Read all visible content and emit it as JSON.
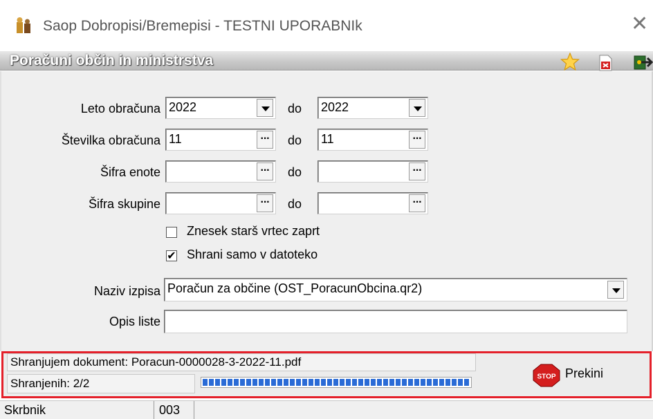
{
  "window": {
    "title": "Saop Dobropisi/Bremepisi - TESTNI UPORABNIk",
    "close_glyph": "✕"
  },
  "header": {
    "title": "Poračuni občin in ministrstva",
    "icons": [
      "star-icon",
      "pdf-delete-icon",
      "exit-icon"
    ]
  },
  "form": {
    "leto": {
      "label": "Leto obračuna",
      "from": "2022",
      "to": "2022",
      "do": "do"
    },
    "stevilka": {
      "label": "Številka obračuna",
      "from": "11",
      "to": "11",
      "do": "do"
    },
    "enota": {
      "label": "Šifra enote",
      "from": "",
      "to": "",
      "do": "do"
    },
    "skupina": {
      "label": "Šifra skupine",
      "from": "",
      "to": "",
      "do": "do"
    },
    "dots": "···",
    "cb_znesek": {
      "label": "Znesek starš vrtec zaprt",
      "checked": false
    },
    "cb_shrani": {
      "label": "Shrani samo v datoteko",
      "checked": true,
      "mark": "✔"
    },
    "naziv": {
      "label": "Naziv izpisa",
      "value": "Poračun za občine  (OST_PoracunObcina.qr2)"
    },
    "opis": {
      "label": "Opis liste",
      "value": ""
    }
  },
  "status": {
    "line1": "Shranjujem dokument: Poracun-0000028-3-2022-11.pdf",
    "line2": "Shranjenih: 2/2",
    "progress": 1.0,
    "stop_text": "STOP",
    "prekini": "Prekini",
    "highlight_color": "#e4202a",
    "progress_color": "#2a6bd6"
  },
  "bottom": {
    "skrbnik": "Skrbnik",
    "code": "003"
  }
}
